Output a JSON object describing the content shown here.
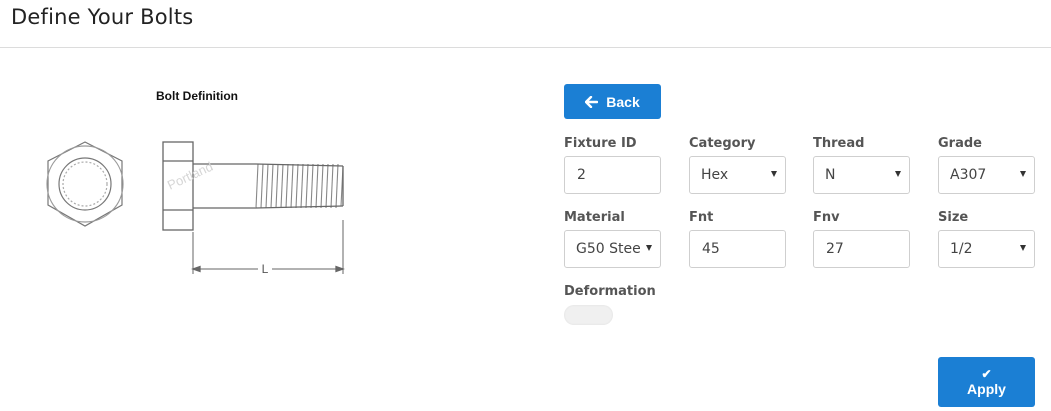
{
  "header": {
    "title": "Define Your Bolts"
  },
  "figure": {
    "title": "Bolt Definition",
    "length_label": "L",
    "watermark": "Portland"
  },
  "buttons": {
    "back": "Back",
    "apply": "Apply"
  },
  "fields": {
    "fixture_id": {
      "label": "Fixture ID",
      "value": "2"
    },
    "category": {
      "label": "Category",
      "value": "Hex"
    },
    "thread": {
      "label": "Thread",
      "value": "N"
    },
    "grade": {
      "label": "Grade",
      "value": "A307"
    },
    "material": {
      "label": "Material",
      "value": "G50 Stee"
    },
    "fnt": {
      "label": "Fnt",
      "value": "45"
    },
    "fnv": {
      "label": "Fnv",
      "value": "27"
    },
    "size": {
      "label": "Size",
      "value": "1/2"
    },
    "deformation": {
      "label": "Deformation",
      "enabled": false
    }
  },
  "colors": {
    "primary": "#1b7fd4"
  }
}
